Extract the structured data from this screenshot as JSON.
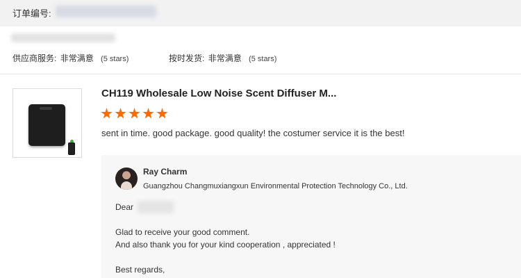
{
  "order": {
    "number_label": "订单编号:"
  },
  "ratings": [
    {
      "label": "供应商服务:",
      "value": "非常满意",
      "stars_text": "(5 stars)"
    },
    {
      "label": "按时发货:",
      "value": "非常满意",
      "stars_text": "(5 stars)"
    }
  ],
  "product": {
    "title": "CH119 Wholesale Low Noise Scent Diffuser M...",
    "star_rating": 5,
    "comment": "sent in time. good package. good quality! the costumer service it is the best!"
  },
  "reply": {
    "name": "Ray Charm",
    "company": "Guangzhou Changmuxiangxun Environmental Protection Technology Co., Ltd.",
    "greeting": "Dear",
    "line1": "Glad to receive your good comment.",
    "line2": "And also thank you for your kind cooperation , appreciated !",
    "line3": "Best regards,"
  },
  "colors": {
    "star": "#ff6a00",
    "order_bar_bg": "#f2f2f2",
    "reply_bg": "#f7f7f7"
  }
}
